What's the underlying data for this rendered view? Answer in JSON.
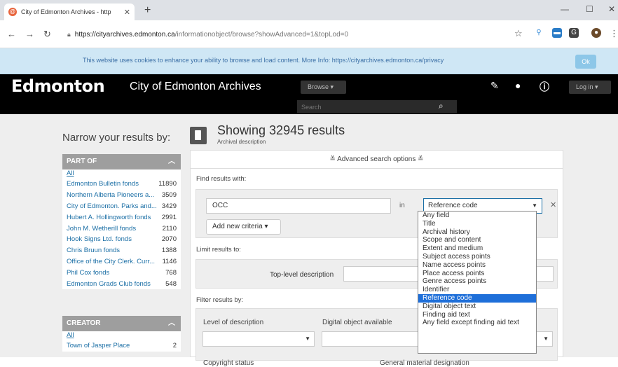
{
  "browser": {
    "tab_title": "City of Edmonton Archives - http",
    "tab_favicon": "@",
    "url_host": "https://cityarchives.edmonton.ca",
    "url_path": "/informationobject/browse?showAdvanced=1&topLod=0"
  },
  "cookie_banner": {
    "text": "This website uses cookies to enhance your ability to browse and load content. More Info: https://cityarchives.edmonton.ca/privacy",
    "ok_label": "Ok"
  },
  "header": {
    "logo": "Edmonton",
    "site_name": "City of Edmonton Archives",
    "browse_label": "Browse ▾",
    "search_placeholder": "Search",
    "login_label": "Log in ▾"
  },
  "sidebar": {
    "title": "Narrow your results by:",
    "part_of": {
      "header": "PART OF",
      "all_label": "All",
      "items": [
        {
          "label": "Edmonton Bulletin fonds",
          "count": "11890"
        },
        {
          "label": "Northern Alberta Pioneers a...",
          "count": "3509"
        },
        {
          "label": "City of Edmonton. Parks and...",
          "count": "3429"
        },
        {
          "label": "Hubert A. Hollingworth fonds",
          "count": "2991"
        },
        {
          "label": "John M. Wetherill fonds",
          "count": "2110"
        },
        {
          "label": "Hook Signs Ltd. fonds",
          "count": "2070"
        },
        {
          "label": "Chris Bruun fonds",
          "count": "1388"
        },
        {
          "label": "Office of the City Clerk. Curr...",
          "count": "1146"
        },
        {
          "label": "Phil Cox fonds",
          "count": "768"
        },
        {
          "label": "Edmonton Grads Club fonds",
          "count": "548"
        }
      ]
    },
    "creator": {
      "header": "CREATOR",
      "all_label": "All",
      "items": [
        {
          "label": "Town of Jasper Place",
          "count": "2"
        }
      ]
    }
  },
  "results": {
    "title": "Showing 32945 results",
    "subtitle": "Archival description"
  },
  "advanced": {
    "toggle_label": "≚ Advanced search options ≚",
    "find_label": "Find results with:",
    "criteria_value": "OCC",
    "in_label": "in",
    "field_selected": "Reference code",
    "add_criteria_label": "Add new criteria ▾",
    "limit_label": "Limit results to:",
    "top_level_label": "Top-level description",
    "filter_label": "Filter results by:",
    "level_label": "Level of description",
    "digital_label": "Digital object available",
    "copyright_label": "Copyright status",
    "gmd_label": "General material designation"
  },
  "field_options": [
    "Any field",
    "Title",
    "Archival history",
    "Scope and content",
    "Extent and medium",
    "Subject access points",
    "Name access points",
    "Place access points",
    "Genre access points",
    "Identifier",
    "Reference code",
    "Digital object text",
    "Finding aid text",
    "Any field except finding aid text"
  ],
  "selected_option_index": 10,
  "colors": {
    "link": "#1a6ea5",
    "header_bg": "#000000",
    "cookie_bg": "#cfe7f5",
    "highlight": "#1e6fd9"
  }
}
